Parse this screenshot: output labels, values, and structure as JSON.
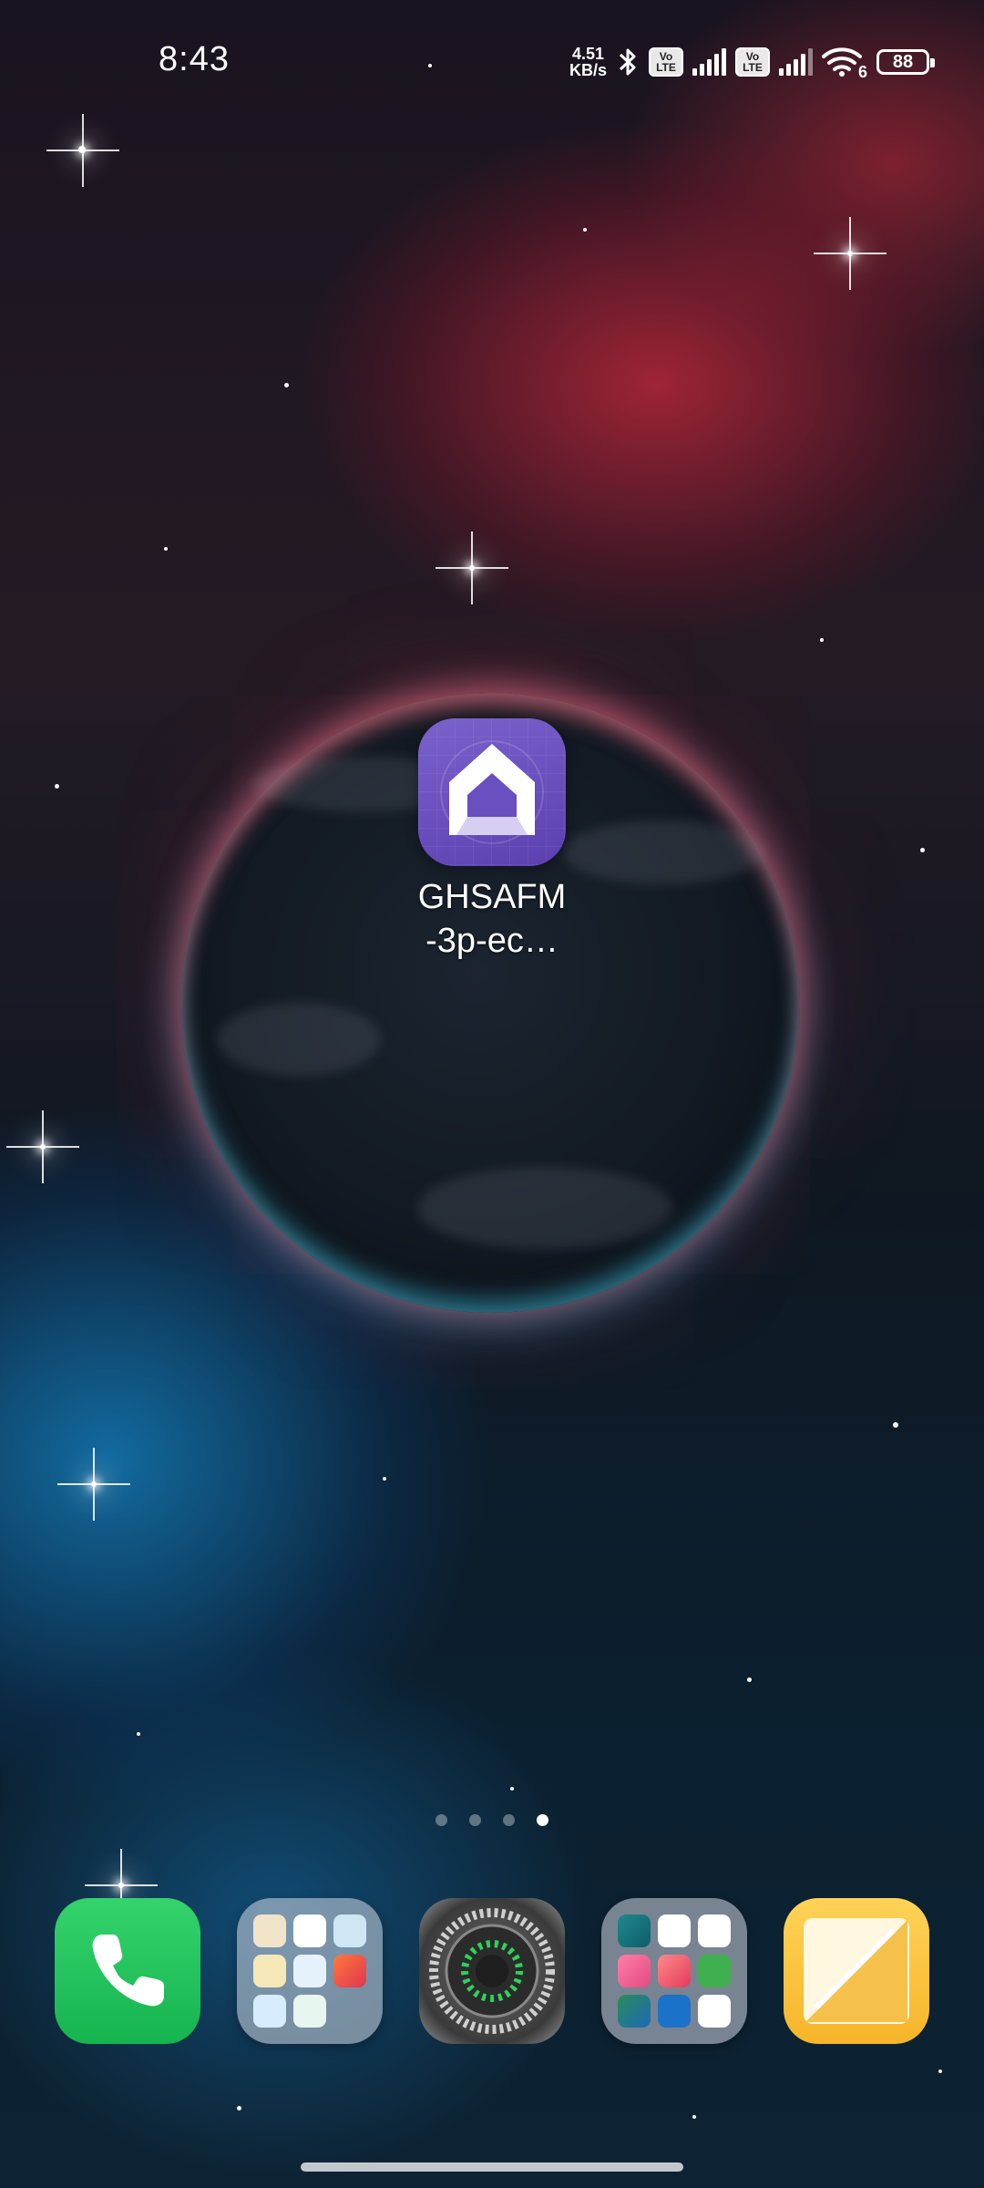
{
  "status_bar": {
    "time": "8:43",
    "net_speed_value": "4.51",
    "net_speed_unit": "KB/s",
    "volte1_top": "Vo",
    "volte1_bottom": "LTE",
    "volte2_top": "Vo",
    "volte2_bottom": "LTE",
    "wifi_badge": "6",
    "battery": "88",
    "icons": [
      "bluetooth-icon",
      "volte-icon",
      "signal-icon",
      "volte-icon",
      "signal-icon",
      "wifi-icon",
      "battery-icon"
    ]
  },
  "home": {
    "apps": [
      {
        "label": "GHSAFM\n-3p-ec…",
        "icon": "home-house-icon",
        "accent": "#6a4fc0"
      }
    ],
    "page_indicator": {
      "pages": 4,
      "active_index": 3
    }
  },
  "dock": {
    "items": [
      {
        "name": "phone",
        "icon": "phone-icon",
        "color": "#22c55e"
      },
      {
        "name": "folder-1",
        "icon": "folder-icon"
      },
      {
        "name": "settings",
        "icon": "gear-icon",
        "color": "#5a5a5a"
      },
      {
        "name": "folder-2",
        "icon": "folder-icon"
      },
      {
        "name": "notes",
        "icon": "notes-icon",
        "color": "#f6b52a"
      }
    ]
  },
  "colors": {
    "accent_purple": "#6a4fc0",
    "phone_green": "#22c55e",
    "notes_yellow": "#f6b52a"
  }
}
